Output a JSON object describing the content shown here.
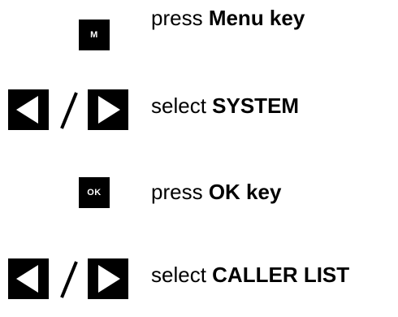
{
  "steps": [
    {
      "key": {
        "type": "square",
        "label": "M",
        "name": "menu-key"
      },
      "verb": "press",
      "target": "Menu key"
    },
    {
      "key": {
        "type": "nav",
        "separator": "/"
      },
      "verb": "select",
      "target": "SYSTEM"
    },
    {
      "key": {
        "type": "square",
        "label": "OK",
        "name": "ok-key"
      },
      "verb": "press",
      "target": "OK key"
    },
    {
      "key": {
        "type": "nav",
        "separator": "/"
      },
      "verb": "select",
      "target": "CALLER LIST"
    }
  ],
  "icons": {
    "left": "left-arrow-key-icon",
    "right": "right-arrow-key-icon"
  },
  "colors": {
    "key_background": "#000000",
    "key_foreground": "#ffffff",
    "text": "#000000"
  }
}
